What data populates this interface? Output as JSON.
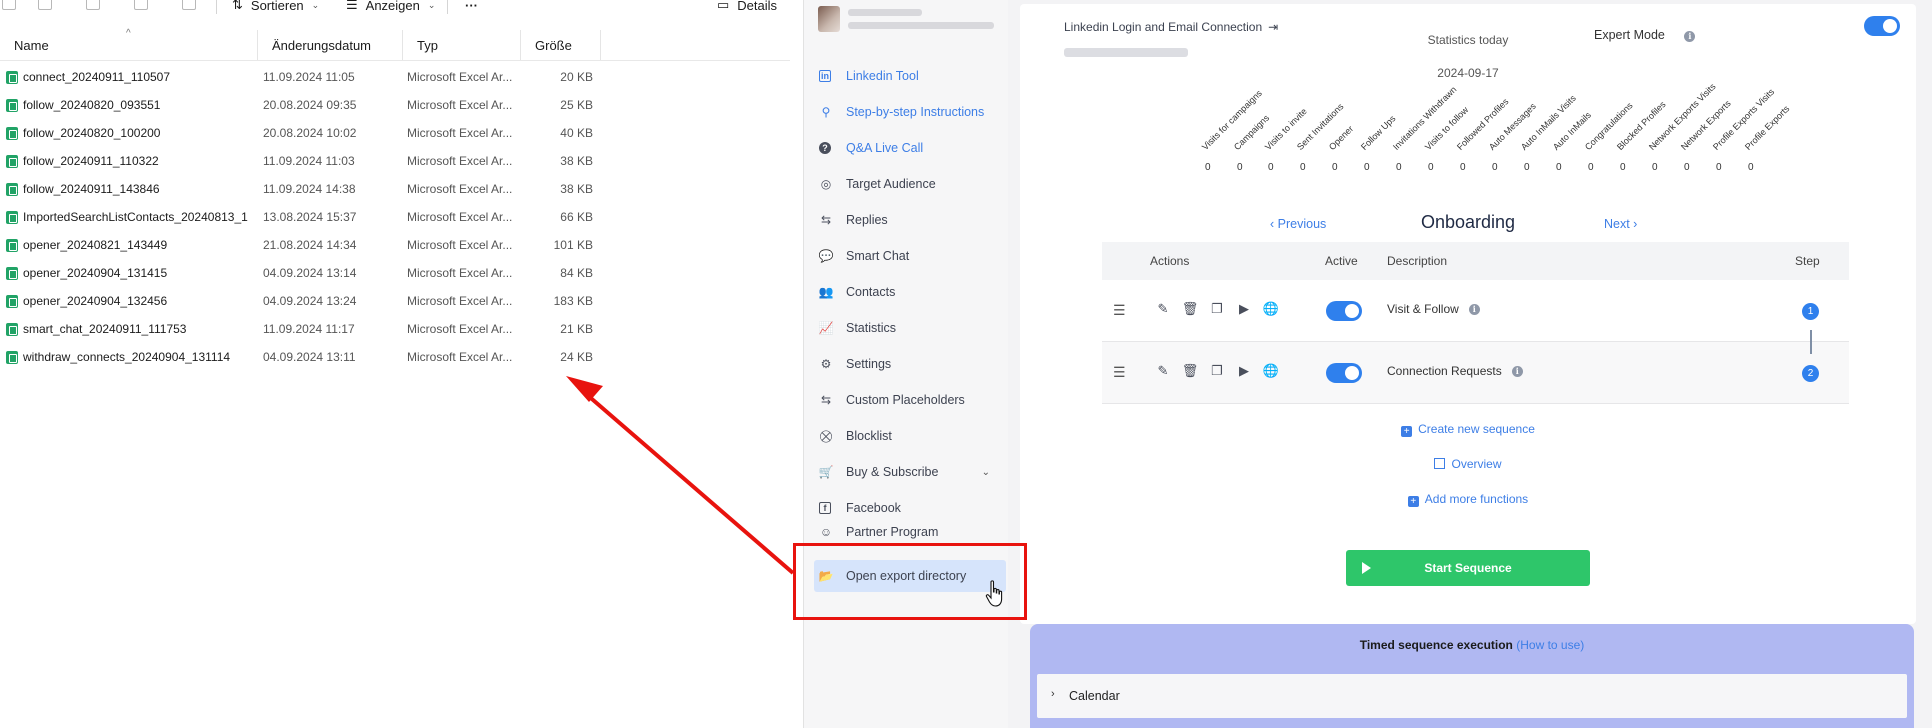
{
  "explorer": {
    "toolbar": {
      "sort_label": "Sortieren",
      "view_label": "Anzeigen",
      "more_label": "···",
      "details_label": "Details"
    },
    "columns": {
      "name": "Name",
      "date": "Änderungsdatum",
      "type": "Typ",
      "size": "Größe"
    },
    "files": [
      {
        "name": "connect_20240911_110507",
        "date": "11.09.2024 11:05",
        "type": "Microsoft Excel Ar...",
        "size": "20 KB"
      },
      {
        "name": "follow_20240820_093551",
        "date": "20.08.2024 09:35",
        "type": "Microsoft Excel Ar...",
        "size": "25 KB"
      },
      {
        "name": "follow_20240820_100200",
        "date": "20.08.2024 10:02",
        "type": "Microsoft Excel Ar...",
        "size": "40 KB"
      },
      {
        "name": "follow_20240911_110322",
        "date": "11.09.2024 11:03",
        "type": "Microsoft Excel Ar...",
        "size": "38 KB"
      },
      {
        "name": "follow_20240911_143846",
        "date": "11.09.2024 14:38",
        "type": "Microsoft Excel Ar...",
        "size": "38 KB"
      },
      {
        "name": "ImportedSearchListContacts_20240813_1...",
        "date": "13.08.2024 15:37",
        "type": "Microsoft Excel Ar...",
        "size": "66 KB"
      },
      {
        "name": "opener_20240821_143449",
        "date": "21.08.2024 14:34",
        "type": "Microsoft Excel Ar...",
        "size": "101 KB"
      },
      {
        "name": "opener_20240904_131415",
        "date": "04.09.2024 13:14",
        "type": "Microsoft Excel Ar...",
        "size": "84 KB"
      },
      {
        "name": "opener_20240904_132456",
        "date": "04.09.2024 13:24",
        "type": "Microsoft Excel Ar...",
        "size": "183 KB"
      },
      {
        "name": "smart_chat_20240911_111753",
        "date": "11.09.2024 11:17",
        "type": "Microsoft Excel Ar...",
        "size": "21 KB"
      },
      {
        "name": "withdraw_connects_20240904_131114",
        "date": "04.09.2024 13:11",
        "type": "Microsoft Excel Ar...",
        "size": "24 KB"
      }
    ]
  },
  "sidebar": {
    "items": [
      {
        "label": "Linkedin Tool",
        "icon": "linkedin-icon"
      },
      {
        "label": "Step-by-step Instructions",
        "icon": "person-stairs-icon"
      },
      {
        "label": "Q&A Live Call",
        "icon": "question-icon"
      },
      {
        "label": "Target Audience",
        "icon": "target-icon"
      },
      {
        "label": "Replies",
        "icon": "replies-icon"
      },
      {
        "label": "Smart Chat",
        "icon": "chat-icon"
      },
      {
        "label": "Contacts",
        "icon": "users-icon"
      },
      {
        "label": "Statistics",
        "icon": "chart-line-icon"
      },
      {
        "label": "Settings",
        "icon": "gear-icon"
      },
      {
        "label": "Custom Placeholders",
        "icon": "placeholder-icon"
      },
      {
        "label": "Blocklist",
        "icon": "blocklist-icon"
      },
      {
        "label": "Buy & Subscribe",
        "icon": "cart-icon"
      },
      {
        "label": "Facebook",
        "icon": "facebook-icon"
      },
      {
        "label": "Partner Program",
        "icon": "partner-icon"
      },
      {
        "label": "Open export directory",
        "icon": "folder-open-icon"
      }
    ]
  },
  "main": {
    "login_link": "Linkedin Login and Email Connection",
    "stats_title": "Statistics today",
    "stats_date": "2024-09-17",
    "expert_mode": "Expert Mode",
    "stats": [
      {
        "label": "Visits for campaigns",
        "value": "0"
      },
      {
        "label": "Campaigns",
        "value": "0"
      },
      {
        "label": "Visits to invite",
        "value": "0"
      },
      {
        "label": "Sent Invitations",
        "value": "0"
      },
      {
        "label": "Opener",
        "value": "0"
      },
      {
        "label": "Follow Ups",
        "value": "0"
      },
      {
        "label": "Invitations Withdrawn",
        "value": "0"
      },
      {
        "label": "Visits to follow",
        "value": "0"
      },
      {
        "label": "Followed Profiles",
        "value": "0"
      },
      {
        "label": "Auto Messages",
        "value": "0"
      },
      {
        "label": "Auto InMails Visits",
        "value": "0"
      },
      {
        "label": "Auto InMails",
        "value": "0"
      },
      {
        "label": "Congratulations",
        "value": "0"
      },
      {
        "label": "Blocked Profiles",
        "value": "0"
      },
      {
        "label": "Network Exports Visits",
        "value": "0"
      },
      {
        "label": "Network Exports",
        "value": "0"
      },
      {
        "label": "Profile Exports Visits",
        "value": "0"
      },
      {
        "label": "Profile Exports",
        "value": "0"
      }
    ],
    "onboarding": {
      "prev": "Previous",
      "title": "Onboarding",
      "next": "Next"
    },
    "table": {
      "headers": {
        "actions": "Actions",
        "active": "Active",
        "description": "Description",
        "step": "Step"
      },
      "rows": [
        {
          "description": "Visit & Follow",
          "step": "1"
        },
        {
          "description": "Connection Requests",
          "step": "2"
        }
      ]
    },
    "links": {
      "create": "Create new sequence",
      "overview": "Overview",
      "add": "Add more functions"
    },
    "start_button": "Start Sequence",
    "timed": {
      "title": "Timed sequence execution",
      "howto": "(How to use)",
      "calendar": "Calendar"
    }
  },
  "colors": {
    "accent": "#2f80ed",
    "start": "#2ec66a",
    "annotation": "#e8130e",
    "timed_bg": "#b0b8f2"
  }
}
